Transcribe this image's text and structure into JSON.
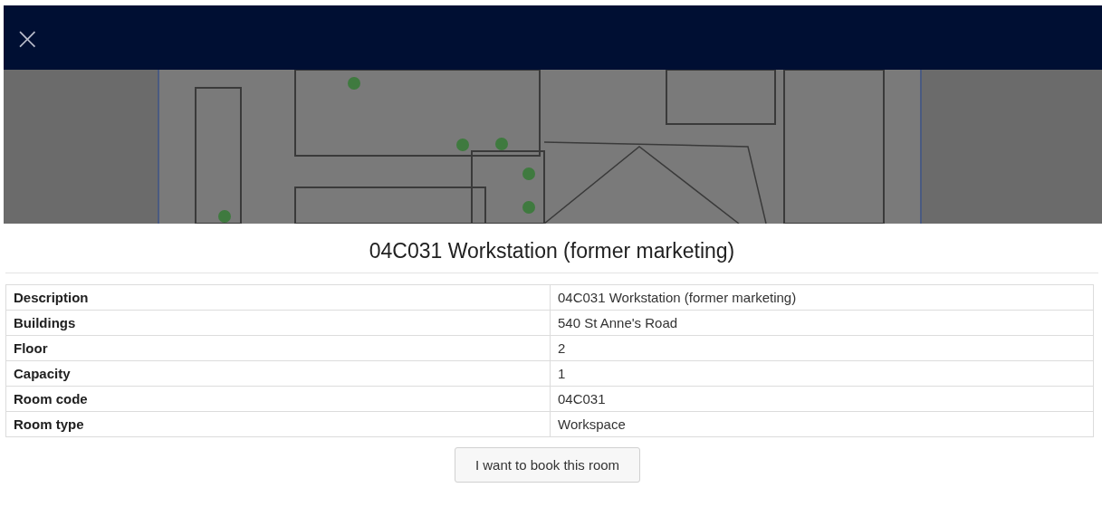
{
  "header": {
    "close_icon": "×"
  },
  "title": "04C031 Workstation (former marketing)",
  "details": [
    {
      "label": "Description",
      "value": "04C031 Workstation (former marketing)"
    },
    {
      "label": "Buildings",
      "value": "540 St Anne's Road"
    },
    {
      "label": "Floor",
      "value": "2"
    },
    {
      "label": "Capacity",
      "value": "1"
    },
    {
      "label": "Room code",
      "value": "04C031"
    },
    {
      "label": "Room type",
      "value": "Workspace"
    }
  ],
  "book_button": "I want to book this room"
}
